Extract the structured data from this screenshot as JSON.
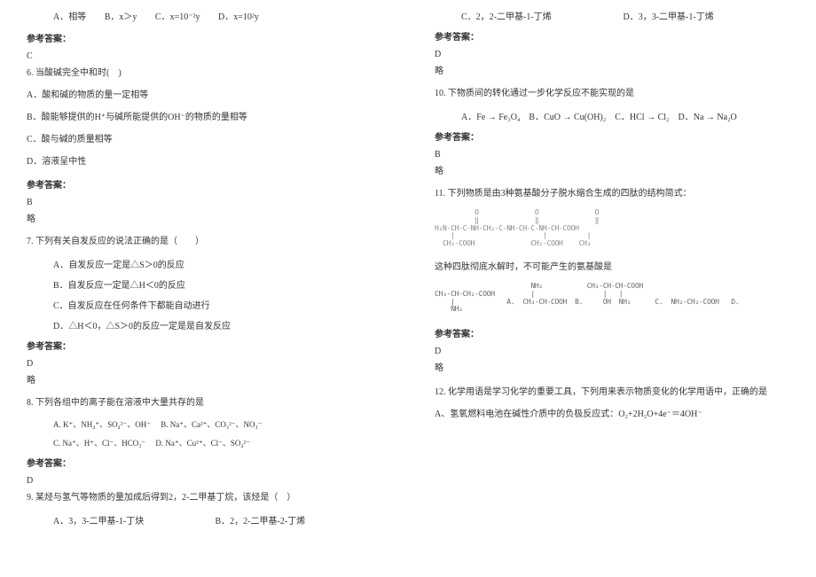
{
  "left": {
    "q5_opts": {
      "a": "A．相等",
      "b": "B．x＞y",
      "c": "C．x=10⁻²y",
      "d": "D．x=10²y"
    },
    "ans_label": "参考答案：",
    "q5_ans": "C",
    "q6": "6. 当酸碱完全中和时(　)",
    "q6a": "A．酸和碱的物质的量一定相等",
    "q6b": "B．酸能够提供的H⁺与碱所能提供的OH⁻的物质的量相等",
    "q6c": "C．酸与碱的质量相等",
    "q6d": "D．溶液呈中性",
    "q6_ans": "B",
    "q6_note": "略",
    "q7": "7. 下列有关自发反应的说法正确的是（　　）",
    "q7a": "A．自发反应一定是△S＞0的反应",
    "q7b": "B．自发反应一定是△H＜0的反应",
    "q7c": "C．自发反应在任何条件下都能自动进行",
    "q7d": "D．△H＜0，△S＞0的反应一定是是自发反应",
    "q7_ans": "D",
    "q7_note": "略",
    "q8": "8. 下列各组中的离子能在溶液中大量共存的是",
    "q8a": "A. K⁺、NH₄⁺、SO₄²⁻、OH⁻",
    "q8b": "B. Na⁺、Ca²⁺、CO₃²⁻、NO₃⁻",
    "q8c": "C. Na⁺、H⁺、Cl⁻、HCO₃⁻",
    "q8d": "D. Na⁺、Cu²⁺、Cl⁻、SO₄²⁻",
    "q8_ans": "D",
    "q9": "9. 某烃与氢气等物质的量加成后得到2，2-二甲基丁烷，该烃是（　）",
    "q9a": "A．3，3-二甲基-1-丁炔",
    "q9b": "B．2，2-二甲基-2-丁烯"
  },
  "right": {
    "q9c": "C．2，2-二甲基-1-丁烯",
    "q9d": "D．3，3-二甲基-1-丁烯",
    "ans_label": "参考答案：",
    "q9_ans": "D",
    "q9_note": "略",
    "q10": "10. 下物质间的转化通过一步化学反应不能实现的是",
    "q10a": "A．Fe → Fe₃O₄",
    "q10b": "B．CuO → Cu(OH)₂",
    "q10c": "C．HCl → Cl₂",
    "q10d": "D．Na → Na₂O",
    "q10_ans": "B",
    "q10_note": "略",
    "q11": "11. 下列物质是由3种氨基酸分子脱水缩合生成的四肽的结构简式：",
    "q11_struct": "          O              O              O\n          ‖              ‖              ‖\nH₂N-CH-C-NH-CH₂-C-NH-CH-C-NH-CH-COOH\n    |                      |          |\n  CH₂-COOH              CH₂-COOH    CH₃",
    "q11_mid": "这种四肽彻底水解时，不可能产生的氨基酸是",
    "q11_opts": "                        NH₂           CH₃-CH-CH-COOH\nCH₃-CH-CH₂-COOH         |                 |   |\n    |             A.  CH₃-CH-COOH  B.     OH  NH₂      C.  NH₂-CH₂-COOH   D.\n    NH₂",
    "q11_ans": "D",
    "q11_note": "略",
    "q12": "12. 化学用语是学习化学的重要工具，下列用来表示物质变化的化学用语中，正确的是",
    "q12a": "A、氢氧燃料电池在碱性介质中的负极反应式：O₂+2H₂O+4e⁻＝4OH⁻"
  }
}
